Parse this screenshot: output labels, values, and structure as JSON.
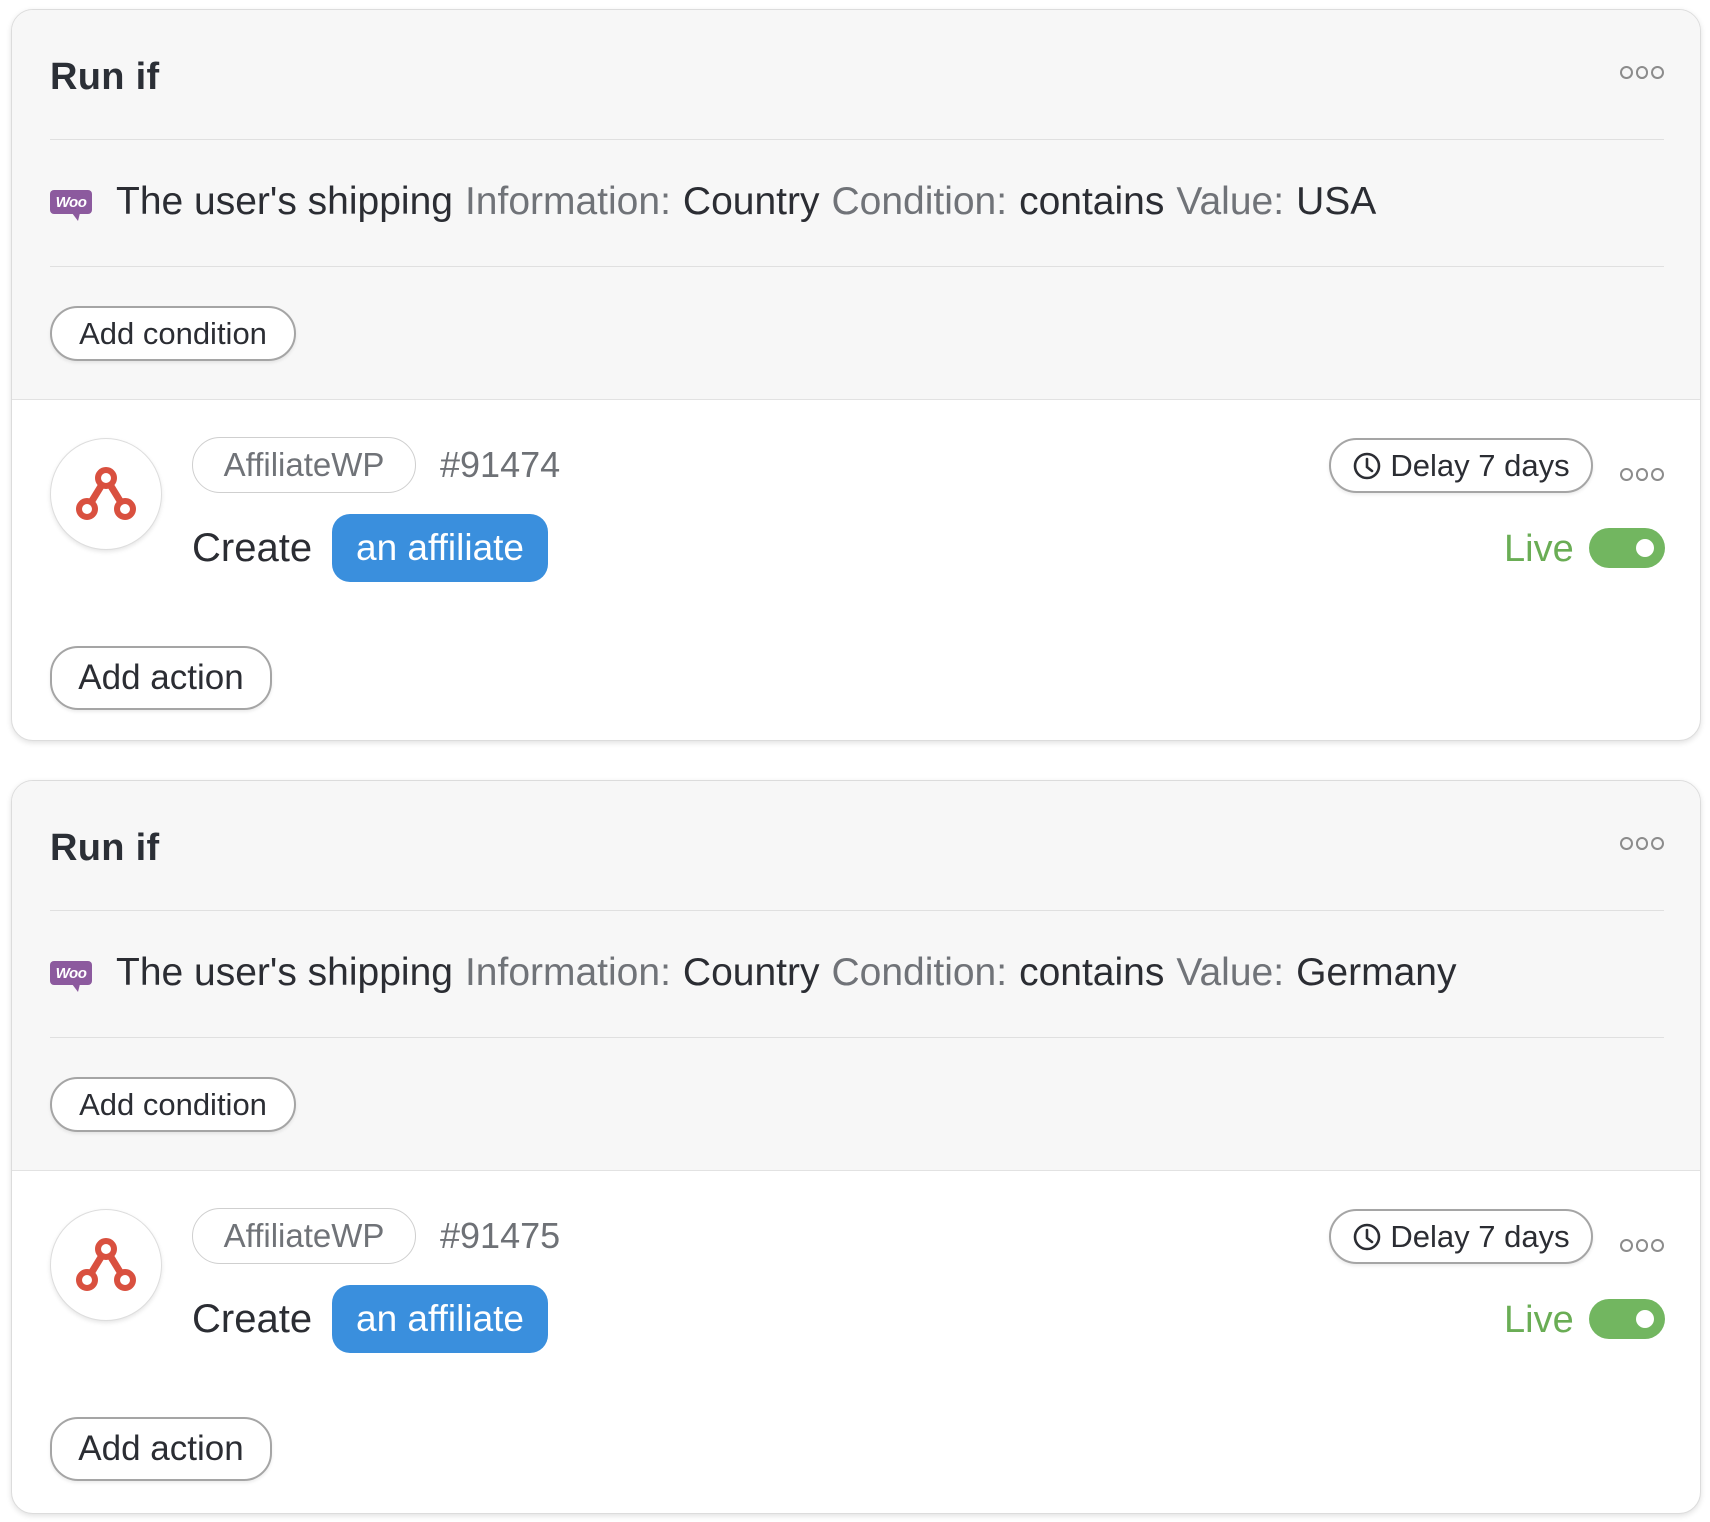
{
  "rules": [
    {
      "title": "Run if",
      "condition": {
        "icon": "woo-icon",
        "icon_text": "Woo",
        "subject": "The user's shipping",
        "field_label": "Information:",
        "field_value": "Country",
        "cond_label": "Condition:",
        "cond_value": "contains",
        "value_label": "Value:",
        "value": "USA"
      },
      "add_condition_label": "Add condition",
      "action": {
        "app": "AffiliateWP",
        "id": "#91474",
        "verb": "Create",
        "object": "an affiliate",
        "delay": "Delay 7 days",
        "status": "Live",
        "enabled": true
      },
      "add_action_label": "Add action"
    },
    {
      "title": "Run if",
      "condition": {
        "icon": "woo-icon",
        "icon_text": "Woo",
        "subject": "The user's shipping",
        "field_label": "Information:",
        "field_value": "Country",
        "cond_label": "Condition:",
        "cond_value": "contains",
        "value_label": "Value:",
        "value": "Germany"
      },
      "add_condition_label": "Add condition",
      "action": {
        "app": "AffiliateWP",
        "id": "#91475",
        "verb": "Create",
        "object": "an affiliate",
        "delay": "Delay 7 days",
        "status": "Live",
        "enabled": true
      },
      "add_action_label": "Add action"
    }
  ],
  "colors": {
    "accent_blue": "#3a8fdd",
    "live_green": "#6aad55",
    "woo_purple": "#8c5a9e",
    "affiliatewp_red": "#d9503f"
  }
}
